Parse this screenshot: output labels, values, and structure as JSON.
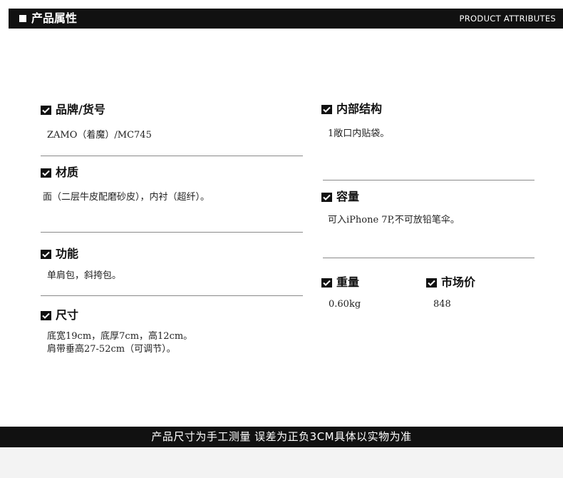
{
  "header": {
    "title": "产品属性",
    "subtitle": "PRODUCT ATTRIBUTES"
  },
  "left": {
    "brand": {
      "label": "品牌/货号",
      "value": "ZAMO（着魔）/MC745"
    },
    "material": {
      "label": "材质",
      "value": "面（二层牛皮配磨砂皮），内衬（超纤）。"
    },
    "function": {
      "label": "功能",
      "value": "单肩包，斜挎包。"
    },
    "size": {
      "label": "尺寸",
      "line1": "底宽19cm，底厚7cm，高12cm。",
      "line2": "肩带垂高27-52cm（可调节）。"
    }
  },
  "right": {
    "structure": {
      "label": "内部结构",
      "value": "1敞口内贴袋。"
    },
    "capacity": {
      "label": "容量",
      "value": "可入iPhone 7P,不可放铅笔伞。"
    },
    "weight": {
      "label": "重量",
      "value": "0.60kg"
    },
    "price": {
      "label": "市场价",
      "value": "848"
    }
  },
  "footer": {
    "note": "产品尺寸为手工测量 误差为正负3CM具体以实物为准"
  },
  "colors": {
    "bar": "#111111",
    "text": "#1a1a1a",
    "divider": "#8a8a8a"
  },
  "icons": {
    "heading": "checkbox-check-icon"
  }
}
